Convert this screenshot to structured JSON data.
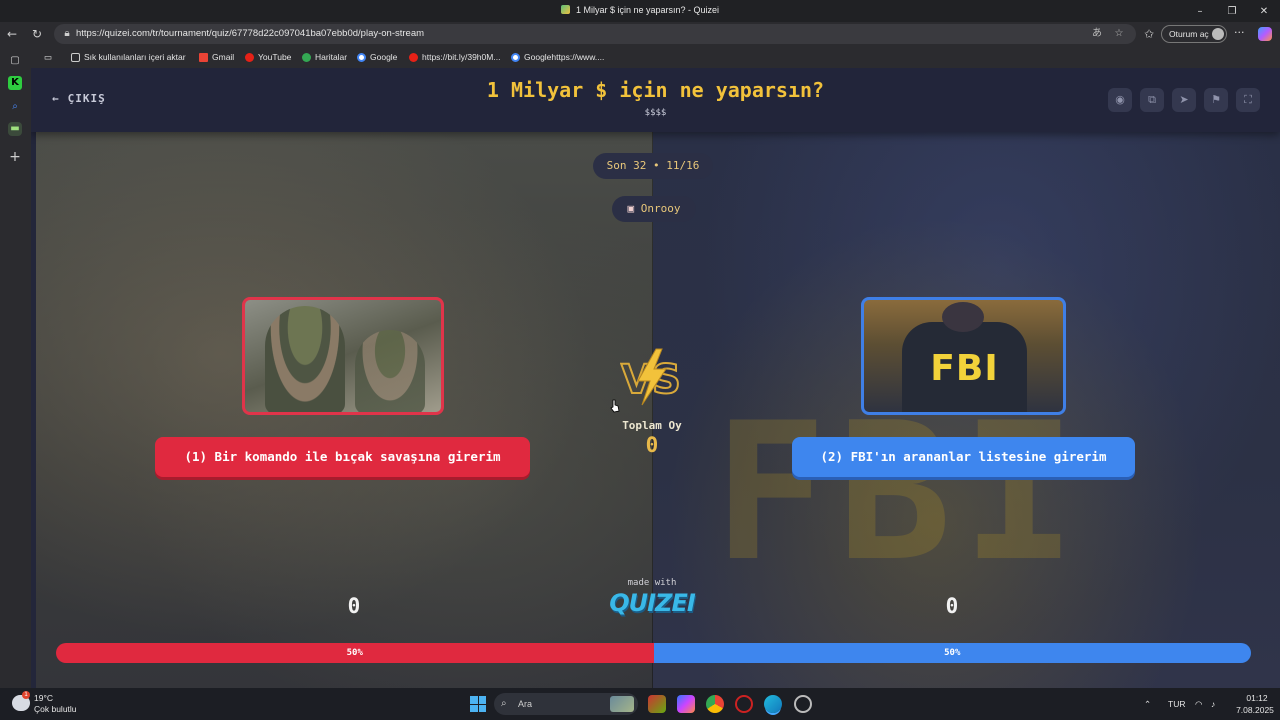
{
  "browser": {
    "window_title": "1 Milyar $ için ne yaparsın? - Quizei",
    "url": "https://quizei.com/tr/tournament/quiz/67778d22c097041ba07ebb0d/play-on-stream",
    "profile_button": "Oturum aç",
    "bookmarks": [
      {
        "label": "Sık kullanılanları içeri aktar",
        "icon": "import-icon"
      },
      {
        "label": "Gmail",
        "icon": "gmail-icon"
      },
      {
        "label": "YouTube",
        "icon": "youtube-icon"
      },
      {
        "label": "Haritalar",
        "icon": "maps-icon"
      },
      {
        "label": "Google",
        "icon": "google-icon"
      },
      {
        "label": "https://bit.ly/39h0M...",
        "icon": "youtube-icon"
      },
      {
        "label": "Googlehttps://www....",
        "icon": "google-icon"
      }
    ]
  },
  "header": {
    "exit_label": "ÇIKIŞ",
    "title": "1 Milyar $ için ne yaparsın?",
    "subtitle": "$$$$"
  },
  "round": {
    "stage": "Son 32 • 11/16",
    "streamer": "Onrooy"
  },
  "left": {
    "answer": "(1) Bir komando ile bıçak savaşına girerim",
    "votes": "0",
    "percent_label": "50%",
    "percent": 50,
    "color": "#e0293f"
  },
  "right": {
    "answer": "(2) FBI'ın arananlar listesine girerim",
    "image_text": "FBI",
    "votes": "0",
    "percent_label": "50%",
    "percent": 50,
    "color": "#3e86ee"
  },
  "total": {
    "label": "Toplam Oy",
    "value": "0"
  },
  "branding": {
    "made_with": "made with",
    "logo": "QUIZEI"
  },
  "taskbar": {
    "temperature": "19°C",
    "weather": "Çok bulutlu",
    "weather_badge": "1",
    "search_placeholder": "Ara",
    "language": "TUR",
    "time": "01:12",
    "date": "7.08.2025"
  }
}
